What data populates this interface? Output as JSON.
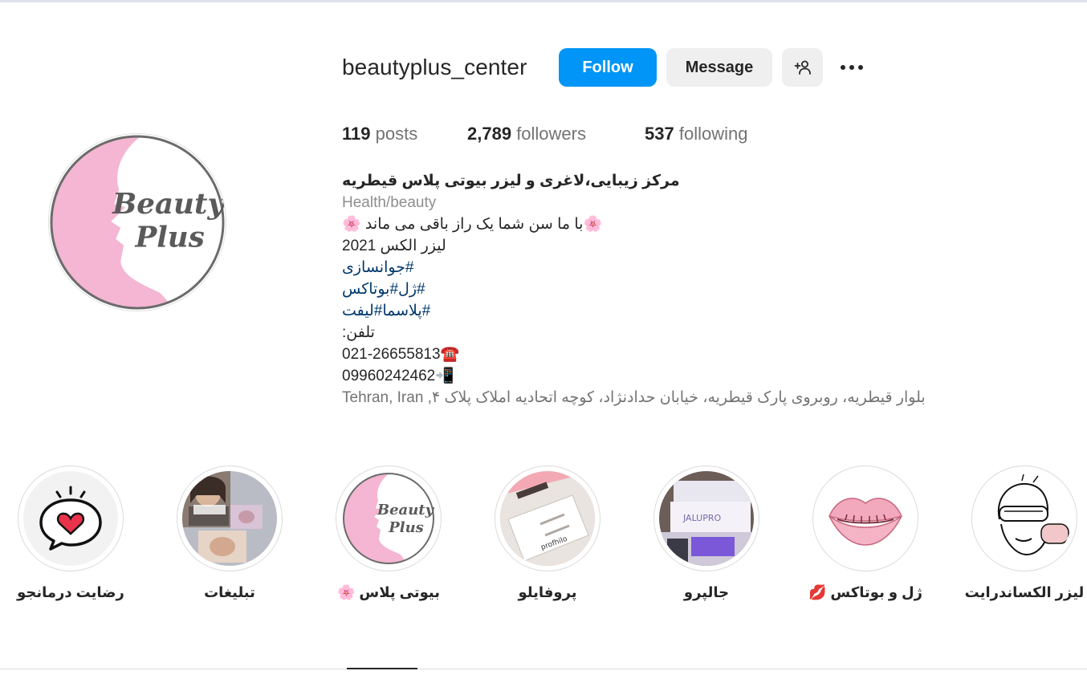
{
  "profile": {
    "username": "beautyplus_center",
    "follow_label": "Follow",
    "message_label": "Message",
    "suggest_icon": "add-person-icon",
    "more_icon": "more-options-icon",
    "avatar_text_1": "Beauty",
    "avatar_text_2": "Plus"
  },
  "stats": {
    "posts_count": "119",
    "posts_label": "posts",
    "followers_count": "2,789",
    "followers_label": "followers",
    "following_count": "537",
    "following_label": "following"
  },
  "bio": {
    "name": "مرکز زیبایی،لاغری و لیزر بیوتی پلاس قیطریه",
    "category": "Health/beauty",
    "line1": "🌸با ما سن شما یک راز باقی می ماند 🌸",
    "line2": "لیزر الکس 2021",
    "tag1": "#جوانسازی",
    "tag2": "#ژل#بوتاکس",
    "tag3": "#پلاسما#لیفت",
    "phone_label": "تلفن:",
    "phone1": "021-26655813☎️",
    "phone2": "09960242462📲",
    "address": "بلوار قیطریه، روبروی پارک قیطریه، خیابان حدادنژاد، کوچه اتحادیه املاک پلاک ۴, Tehran, Iran"
  },
  "highlights": [
    {
      "label": "رضایت درمانجو",
      "icon": "heart-speech-bubble-icon"
    },
    {
      "label": "تبلیغات",
      "icon": "advert-photo-collage"
    },
    {
      "label": "بیوتی پلاس 🌸",
      "icon": "beauty-plus-logo"
    },
    {
      "label": "پروفایلو",
      "icon": "profhilo-product-photo"
    },
    {
      "label": "جالپرو",
      "icon": "jalupro-product-photo"
    },
    {
      "label": "ژل و بوتاکس 💋",
      "icon": "lips-icon"
    },
    {
      "label": "لیزر الکساندرایت",
      "icon": "laser-face-icon"
    }
  ],
  "colors": {
    "follow_blue": "#0095f6",
    "avatar_pink": "#f4b6d2",
    "hashtag_blue": "#00376b"
  }
}
